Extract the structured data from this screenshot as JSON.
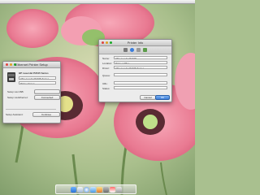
{
  "desktop": {
    "wallpaper_subject": "pink poppies"
  },
  "menubar": {
    "apple_glyph": ""
  },
  "left_window": {
    "title": "Ethernet Printer Setup",
    "printer_name": "HP LaserJet P2015 Series",
    "fields": [
      {
        "label": "",
        "value": "HP LaserJet P2015 Series"
      },
      {
        "label": "",
        "value": "Printer Setup"
      }
    ],
    "options": [
      {
        "label": "Setup via USB:",
        "value": ""
      },
      {
        "label": "Setup via Ethernet:",
        "value": "Connected"
      }
    ],
    "footer_label": "Setup Assistant:",
    "footer_button": "Continue"
  },
  "right_window": {
    "title": "Printer Info",
    "toolbar_icons": [
      "general-icon",
      "info-icon",
      "driver-icon",
      "supply-icon"
    ],
    "rows": [
      {
        "label": "Name:",
        "value": "HP LaserJet P2015"
      },
      {
        "label": "Location:",
        "value": "Printer Office"
      },
      {
        "label": "Driver:",
        "value": "HP LaserJet P2015 Series"
      },
      {
        "label": "Queue:",
        "value": ""
      },
      {
        "label": "URL:",
        "value": ""
      },
      {
        "label": "Status:",
        "value": ""
      }
    ],
    "buttons": {
      "cancel": "Cancel",
      "ok": "OK"
    }
  },
  "dock": {
    "icons": [
      "finder-icon",
      "mail-icon",
      "safari-icon",
      "itunes-icon",
      "photos-icon",
      "system-prefs-icon",
      "calendar-icon",
      "trash-icon"
    ]
  },
  "colors": {
    "close": "#e0443e",
    "minimize": "#dea123",
    "zoom": "#1aab29",
    "accent": "#3b7ddb"
  }
}
